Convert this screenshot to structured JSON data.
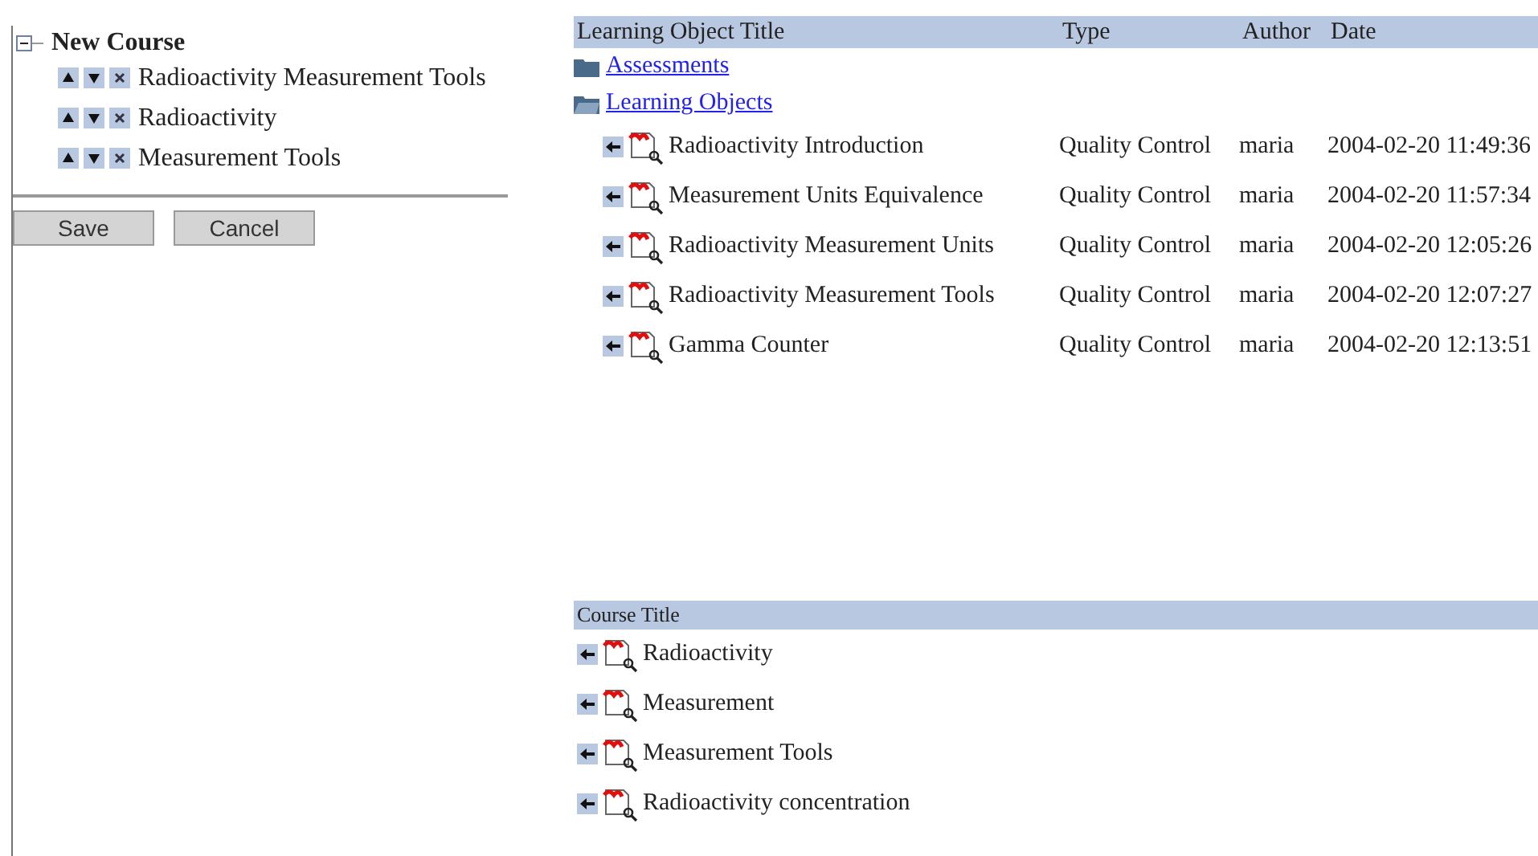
{
  "course_tree": {
    "title": "New Course",
    "expanded": true,
    "items": [
      {
        "label": "Radioactivity Measurement Tools"
      },
      {
        "label": "Radioactivity"
      },
      {
        "label": "Measurement Tools"
      }
    ]
  },
  "buttons": [
    "Save",
    "Cancel"
  ],
  "learning_objects": {
    "columns": [
      "Learning Object Title",
      "Type",
      "Author",
      "Date"
    ],
    "folders": [
      {
        "label": "Assessments",
        "expanded": false
      },
      {
        "label": "Learning Objects",
        "expanded": true
      }
    ],
    "rows": [
      {
        "title": "Radioactivity Introduction",
        "type": "Quality Control",
        "author": "maria",
        "date": "2004-02-20 11:49:36"
      },
      {
        "title": "Measurement Units Equivalence",
        "type": "Quality Control",
        "author": "maria",
        "date": "2004-02-20 11:57:34"
      },
      {
        "title": "Radioactivity Measurement Units",
        "type": "Quality Control",
        "author": "maria",
        "date": "2004-02-20 12:05:26"
      },
      {
        "title": "Radioactivity Measurement Tools",
        "type": "Quality Control",
        "author": "maria",
        "date": "2004-02-20 12:07:27"
      },
      {
        "title": "Gamma Counter",
        "type": "Quality Control",
        "author": "maria",
        "date": "2004-02-20 12:13:51"
      }
    ]
  },
  "courses": {
    "column": "Course Title",
    "rows": [
      {
        "title": "Radioactivity"
      },
      {
        "title": "Measurement"
      },
      {
        "title": "Measurement Tools"
      },
      {
        "title": "Radioactivity concentration"
      }
    ]
  }
}
